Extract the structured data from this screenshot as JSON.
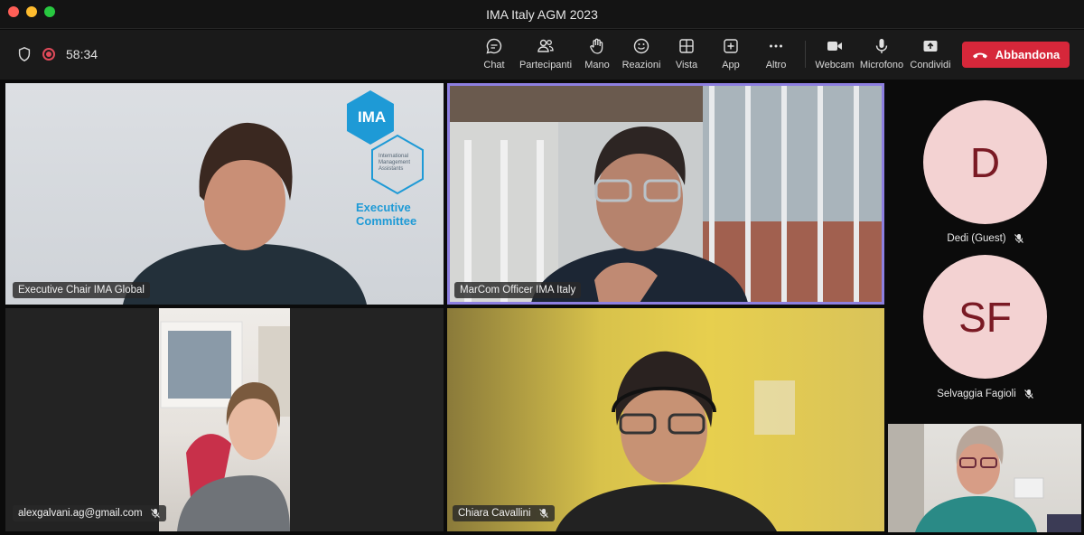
{
  "window": {
    "title": "IMA Italy AGM 2023"
  },
  "toolbar": {
    "timer": "58:34",
    "buttons": [
      {
        "label": "Chat",
        "icon": "chat-icon"
      },
      {
        "label": "Partecipanti",
        "icon": "participants-icon"
      },
      {
        "label": "Mano",
        "icon": "hand-icon"
      },
      {
        "label": "Reazioni",
        "icon": "smiley-icon"
      },
      {
        "label": "Vista",
        "icon": "grid-view-icon"
      },
      {
        "label": "App",
        "icon": "add-app-icon"
      },
      {
        "label": "Altro",
        "icon": "more-icon"
      },
      {
        "label": "Webcam",
        "icon": "camera-icon"
      },
      {
        "label": "Microfono",
        "icon": "microphone-icon"
      },
      {
        "label": "Condividi",
        "icon": "share-icon"
      }
    ],
    "leave_label": "Abbandona"
  },
  "tiles": [
    {
      "name": "Executive Chair IMA Global",
      "muted": false
    },
    {
      "name": "MarCom Officer IMA Italy",
      "muted": false,
      "active_speaker": true
    },
    {
      "name": "alexgalvani.ag@gmail.com",
      "muted": true
    },
    {
      "name": "Chiara Cavallini",
      "muted": true
    }
  ],
  "slide": {
    "logo_text": "IMA",
    "logo_subtext": "International Management Assistants",
    "caption_line1": "Executive",
    "caption_line2": "Committee"
  },
  "side_participants": [
    {
      "initials": "D",
      "name": "Dedi (Guest)",
      "muted": true
    },
    {
      "initials": "SF",
      "name": "Selvaggia Fagioli",
      "muted": true
    }
  ],
  "colors": {
    "leave_button": "#d6273a",
    "active_speaker_border": "#8d7fe0",
    "avatar_bg": "#f3d2d2",
    "avatar_text": "#7a1a24",
    "ima_blue": "#1e9ad6"
  }
}
